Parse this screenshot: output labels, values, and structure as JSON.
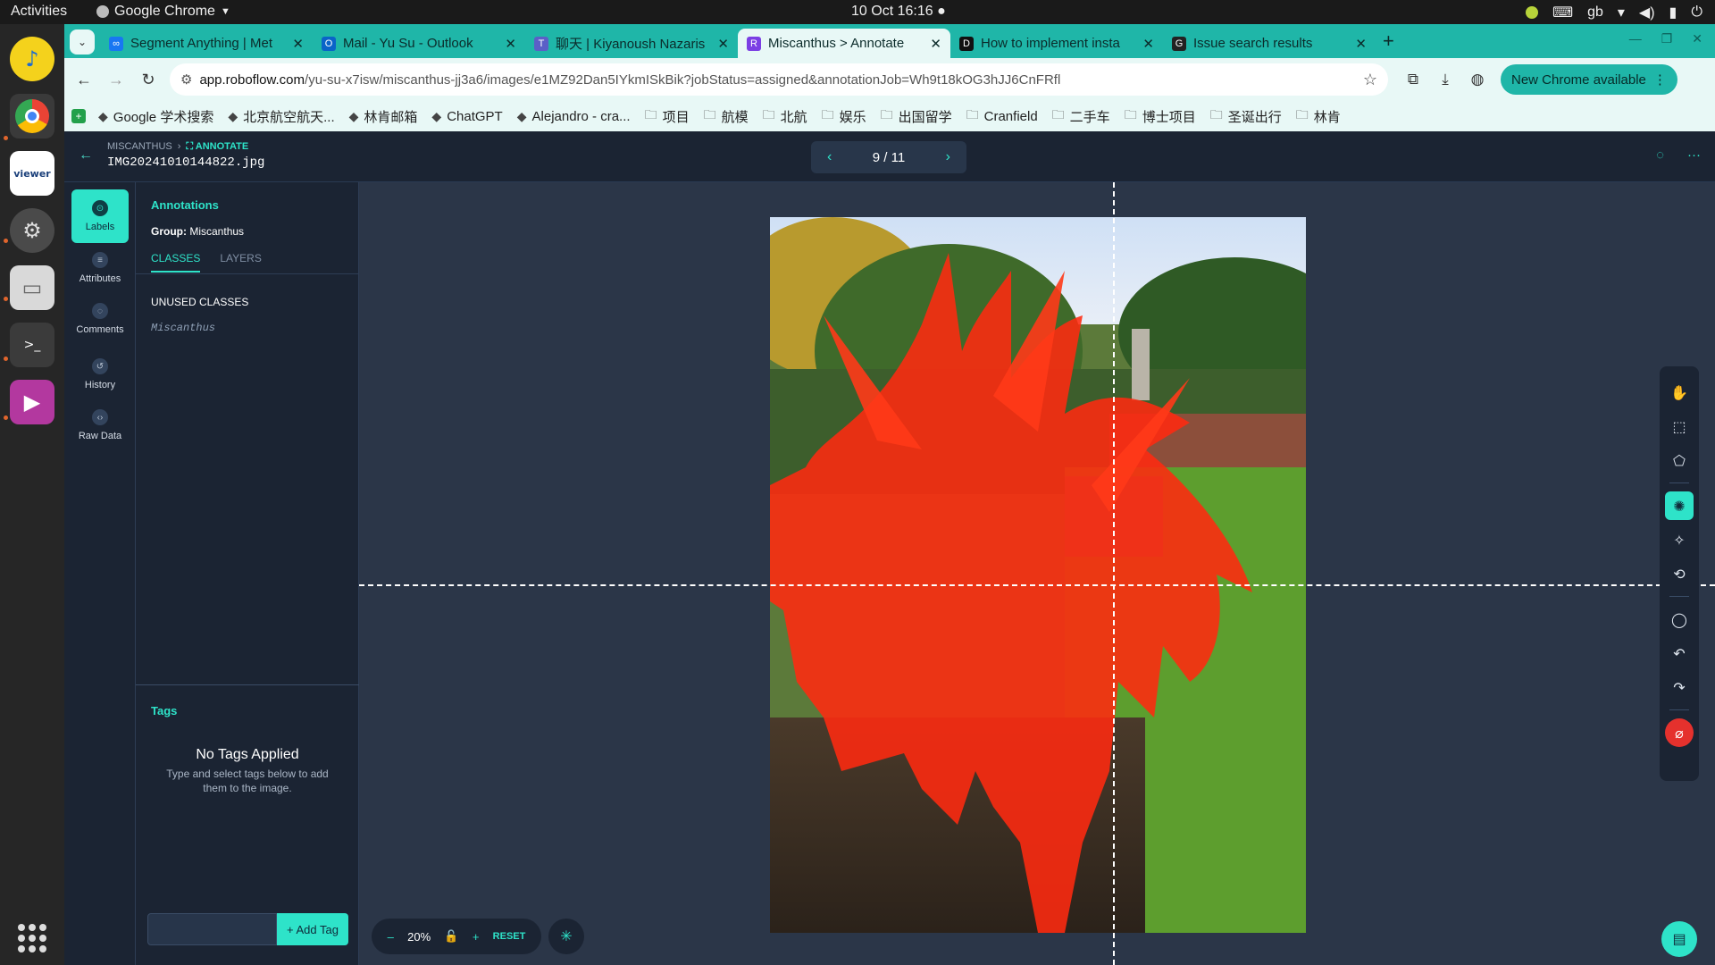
{
  "os": {
    "activities": "Activities",
    "app_name": "Google Chrome",
    "clock": "10 Oct  16:16",
    "keyboard": "gb"
  },
  "tabs": [
    {
      "title": "Segment Anything | Met",
      "icon": "meta-icon",
      "color": "#1877f2",
      "glyph": "∞"
    },
    {
      "title": "Mail - Yu Su - Outlook",
      "icon": "outlook-icon",
      "color": "#0a64c8",
      "glyph": "O"
    },
    {
      "title": "聊天 | Kiyanoush Nazaris",
      "icon": "teams-icon",
      "color": "#5b5fc7",
      "glyph": "T"
    },
    {
      "title": "Miscanthus > Annotate",
      "icon": "roboflow-icon",
      "color": "#7b3fe4",
      "glyph": "R",
      "active": true
    },
    {
      "title": "How to implement insta",
      "icon": "dev-icon",
      "color": "#111111",
      "glyph": "D"
    },
    {
      "title": "Issue search results",
      "icon": "github-icon",
      "color": "#222222",
      "glyph": "G"
    }
  ],
  "address": {
    "host": "app.roboflow.com",
    "path": "/yu-su-x7isw/miscanthus-jj3a6/images/e1MZ92Dan5IYkmISkBik?jobStatus=assigned&annotationJob=Wh9t18kOG3hJJ6CnFRfl",
    "update_label": "New Chrome available"
  },
  "bookmarks": [
    {
      "label": "Google 学术搜索",
      "icon": "scholar-icon"
    },
    {
      "label": "北京航空航天...",
      "icon": "buaa-icon"
    },
    {
      "label": "林肯邮箱",
      "icon": "outlook-icon"
    },
    {
      "label": "ChatGPT",
      "icon": "chatgpt-icon"
    },
    {
      "label": "Alejandro - cra...",
      "icon": "slack-icon"
    },
    {
      "label": "项目",
      "icon": "folder-icon"
    },
    {
      "label": "航模",
      "icon": "folder-icon"
    },
    {
      "label": "北航",
      "icon": "folder-icon"
    },
    {
      "label": "娱乐",
      "icon": "folder-icon"
    },
    {
      "label": "出国留学",
      "icon": "folder-icon"
    },
    {
      "label": "Cranfield",
      "icon": "folder-icon"
    },
    {
      "label": "二手车",
      "icon": "folder-icon"
    },
    {
      "label": "博士项目",
      "icon": "folder-icon"
    },
    {
      "label": "圣诞出行",
      "icon": "folder-icon"
    },
    {
      "label": "林肯",
      "icon": "folder-icon"
    }
  ],
  "header": {
    "project": "MISCANTHUS",
    "section": "ANNOTATE",
    "filename": "IMG20241010144822.jpg",
    "pager": "9 / 11"
  },
  "rail": [
    {
      "label": "Labels",
      "icon": "tag-icon",
      "active": true
    },
    {
      "label": "Attributes",
      "icon": "list-icon"
    },
    {
      "label": "Comments",
      "icon": "comment-icon"
    },
    {
      "label": "History",
      "icon": "history-icon"
    },
    {
      "label": "Raw Data",
      "icon": "code-icon"
    }
  ],
  "panel": {
    "title": "Annotations",
    "group_label": "Group:",
    "group_value": "Miscanthus",
    "tab_classes": "CLASSES",
    "tab_layers": "LAYERS",
    "unused_title": "UNUSED CLASSES",
    "class_name": "Miscanthus",
    "tags_title": "Tags",
    "no_tags": "No Tags Applied",
    "no_tags_sub": "Type and select tags below to add them to the image.",
    "add_tag": "+ Add Tag"
  },
  "canvas": {
    "zoom": "20%",
    "reset": "RESET"
  },
  "colors": {
    "accent": "#2ee3c9",
    "mask": "#ff2a10",
    "chrome_theme": "#1fb6a8"
  },
  "tools": [
    "pan-hand-icon",
    "bounding-box-icon",
    "polygon-icon",
    "smart-polygon-icon",
    "magic-wand-icon",
    "repeat-icon",
    "comment-icon",
    "undo-icon",
    "redo-icon",
    "null-annotation-icon"
  ]
}
